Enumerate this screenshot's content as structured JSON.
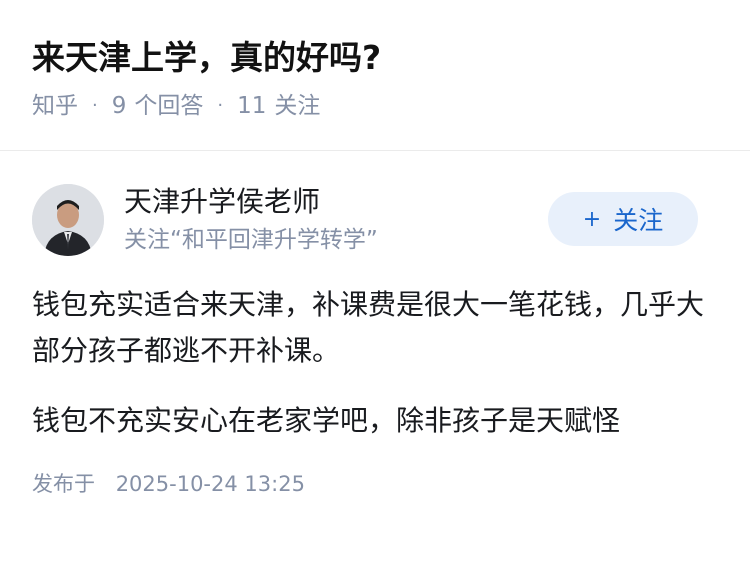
{
  "question": {
    "title": "来天津上学，真的好吗?",
    "source": "知乎",
    "answers_count": "9",
    "answers_label": "个回答",
    "followers_count": "11",
    "followers_label": "关注"
  },
  "answer": {
    "author": {
      "name": "天津升学侯老师",
      "subtitle": "关注“和平回津升学转学”"
    },
    "follow_button": {
      "icon": "plus-icon",
      "plus": "+",
      "label": "关注"
    },
    "paragraphs": [
      "钱包充实适合来天津，补课费是很大一笔花钱，几乎大部分孩子都逃不开补课。",
      "钱包不充实安心在老家学吧，除非孩子是天赋怪"
    ],
    "publish_label": "发布于",
    "publish_time": "2025-10-24 13:25"
  },
  "colors": {
    "accent": "#1a66cc",
    "follow_bg": "#e8f0fb",
    "meta": "#8590a6"
  }
}
